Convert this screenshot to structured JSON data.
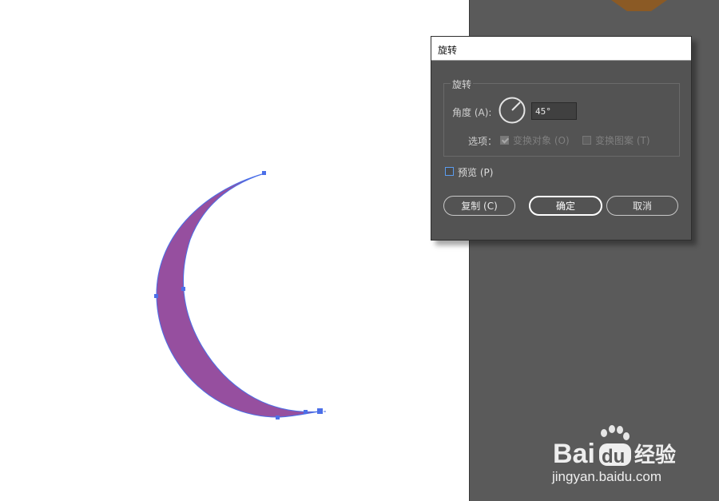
{
  "dialog": {
    "title": "旋转",
    "group_label": "旋转",
    "angle_label": "角度 (A):",
    "angle_value": "45°",
    "options_label": "选项：",
    "option_transform_objects": "变换对象 (O)",
    "option_transform_patterns": "变换图案 (T)",
    "preview_label": "预览 (P)",
    "copy_button": "复制 (C)",
    "ok_button": "确定",
    "cancel_button": "取消"
  },
  "watermark": {
    "brand_prefix": "Bai",
    "brand_paw": "du",
    "brand_suffix": "经验",
    "url": "jingyan.baidu.com"
  },
  "colors": {
    "shape_fill": "#964f9f",
    "shape_stroke": "#4b6fe8",
    "panel_bg": "#5a5a5a",
    "dialog_bg": "#535353"
  }
}
